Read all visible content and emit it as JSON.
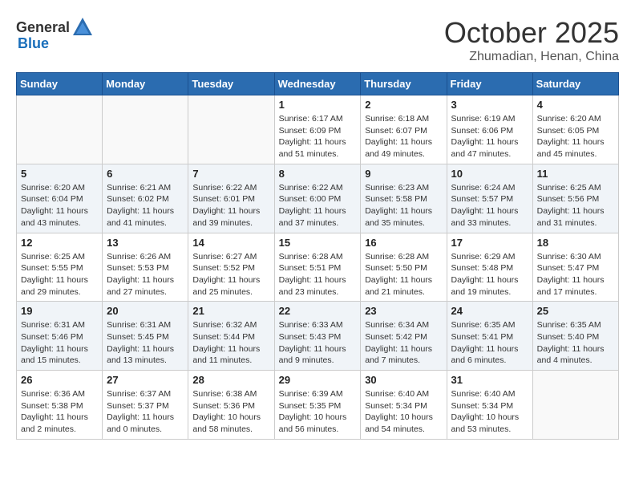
{
  "header": {
    "logo_general": "General",
    "logo_blue": "Blue",
    "month": "October 2025",
    "location": "Zhumadian, Henan, China"
  },
  "weekdays": [
    "Sunday",
    "Monday",
    "Tuesday",
    "Wednesday",
    "Thursday",
    "Friday",
    "Saturday"
  ],
  "weeks": [
    [
      {
        "day": "",
        "info": ""
      },
      {
        "day": "",
        "info": ""
      },
      {
        "day": "",
        "info": ""
      },
      {
        "day": "1",
        "info": "Sunrise: 6:17 AM\nSunset: 6:09 PM\nDaylight: 11 hours\nand 51 minutes."
      },
      {
        "day": "2",
        "info": "Sunrise: 6:18 AM\nSunset: 6:07 PM\nDaylight: 11 hours\nand 49 minutes."
      },
      {
        "day": "3",
        "info": "Sunrise: 6:19 AM\nSunset: 6:06 PM\nDaylight: 11 hours\nand 47 minutes."
      },
      {
        "day": "4",
        "info": "Sunrise: 6:20 AM\nSunset: 6:05 PM\nDaylight: 11 hours\nand 45 minutes."
      }
    ],
    [
      {
        "day": "5",
        "info": "Sunrise: 6:20 AM\nSunset: 6:04 PM\nDaylight: 11 hours\nand 43 minutes."
      },
      {
        "day": "6",
        "info": "Sunrise: 6:21 AM\nSunset: 6:02 PM\nDaylight: 11 hours\nand 41 minutes."
      },
      {
        "day": "7",
        "info": "Sunrise: 6:22 AM\nSunset: 6:01 PM\nDaylight: 11 hours\nand 39 minutes."
      },
      {
        "day": "8",
        "info": "Sunrise: 6:22 AM\nSunset: 6:00 PM\nDaylight: 11 hours\nand 37 minutes."
      },
      {
        "day": "9",
        "info": "Sunrise: 6:23 AM\nSunset: 5:58 PM\nDaylight: 11 hours\nand 35 minutes."
      },
      {
        "day": "10",
        "info": "Sunrise: 6:24 AM\nSunset: 5:57 PM\nDaylight: 11 hours\nand 33 minutes."
      },
      {
        "day": "11",
        "info": "Sunrise: 6:25 AM\nSunset: 5:56 PM\nDaylight: 11 hours\nand 31 minutes."
      }
    ],
    [
      {
        "day": "12",
        "info": "Sunrise: 6:25 AM\nSunset: 5:55 PM\nDaylight: 11 hours\nand 29 minutes."
      },
      {
        "day": "13",
        "info": "Sunrise: 6:26 AM\nSunset: 5:53 PM\nDaylight: 11 hours\nand 27 minutes."
      },
      {
        "day": "14",
        "info": "Sunrise: 6:27 AM\nSunset: 5:52 PM\nDaylight: 11 hours\nand 25 minutes."
      },
      {
        "day": "15",
        "info": "Sunrise: 6:28 AM\nSunset: 5:51 PM\nDaylight: 11 hours\nand 23 minutes."
      },
      {
        "day": "16",
        "info": "Sunrise: 6:28 AM\nSunset: 5:50 PM\nDaylight: 11 hours\nand 21 minutes."
      },
      {
        "day": "17",
        "info": "Sunrise: 6:29 AM\nSunset: 5:48 PM\nDaylight: 11 hours\nand 19 minutes."
      },
      {
        "day": "18",
        "info": "Sunrise: 6:30 AM\nSunset: 5:47 PM\nDaylight: 11 hours\nand 17 minutes."
      }
    ],
    [
      {
        "day": "19",
        "info": "Sunrise: 6:31 AM\nSunset: 5:46 PM\nDaylight: 11 hours\nand 15 minutes."
      },
      {
        "day": "20",
        "info": "Sunrise: 6:31 AM\nSunset: 5:45 PM\nDaylight: 11 hours\nand 13 minutes."
      },
      {
        "day": "21",
        "info": "Sunrise: 6:32 AM\nSunset: 5:44 PM\nDaylight: 11 hours\nand 11 minutes."
      },
      {
        "day": "22",
        "info": "Sunrise: 6:33 AM\nSunset: 5:43 PM\nDaylight: 11 hours\nand 9 minutes."
      },
      {
        "day": "23",
        "info": "Sunrise: 6:34 AM\nSunset: 5:42 PM\nDaylight: 11 hours\nand 7 minutes."
      },
      {
        "day": "24",
        "info": "Sunrise: 6:35 AM\nSunset: 5:41 PM\nDaylight: 11 hours\nand 6 minutes."
      },
      {
        "day": "25",
        "info": "Sunrise: 6:35 AM\nSunset: 5:40 PM\nDaylight: 11 hours\nand 4 minutes."
      }
    ],
    [
      {
        "day": "26",
        "info": "Sunrise: 6:36 AM\nSunset: 5:38 PM\nDaylight: 11 hours\nand 2 minutes."
      },
      {
        "day": "27",
        "info": "Sunrise: 6:37 AM\nSunset: 5:37 PM\nDaylight: 11 hours\nand 0 minutes."
      },
      {
        "day": "28",
        "info": "Sunrise: 6:38 AM\nSunset: 5:36 PM\nDaylight: 10 hours\nand 58 minutes."
      },
      {
        "day": "29",
        "info": "Sunrise: 6:39 AM\nSunset: 5:35 PM\nDaylight: 10 hours\nand 56 minutes."
      },
      {
        "day": "30",
        "info": "Sunrise: 6:40 AM\nSunset: 5:34 PM\nDaylight: 10 hours\nand 54 minutes."
      },
      {
        "day": "31",
        "info": "Sunrise: 6:40 AM\nSunset: 5:34 PM\nDaylight: 10 hours\nand 53 minutes."
      },
      {
        "day": "",
        "info": ""
      }
    ]
  ]
}
